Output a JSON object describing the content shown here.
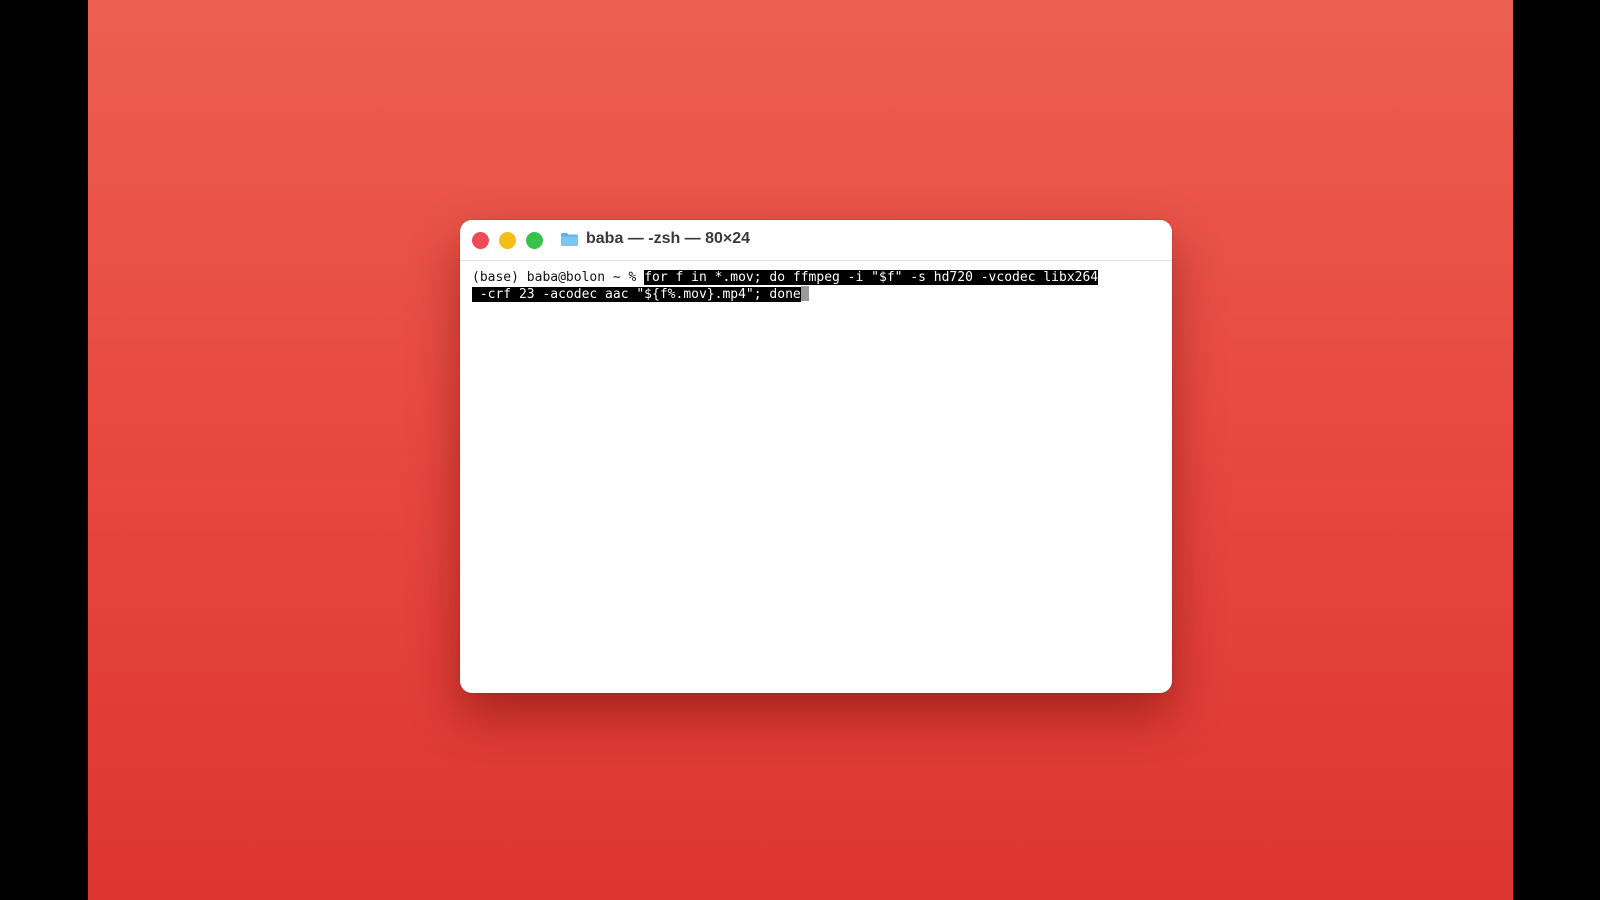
{
  "window": {
    "title": "baba — -zsh — 80×24"
  },
  "terminal": {
    "prompt": "(base) baba@bolon ~ % ",
    "command_line_1": "for f in *.mov; do ffmpeg -i \"$f\" -s hd720 -vcodec libx264",
    "command_line_2": " -crf 23 -acodec aac \"${f%.mov}.mp4\"; done"
  },
  "icons": {
    "close": "close-button",
    "minimize": "minimize-button",
    "zoom": "zoom-button",
    "folder": "folder-icon"
  },
  "colors": {
    "desktop_top": "#ec5f50",
    "desktop_bottom": "#dd3530",
    "close": "#ee4b57",
    "minimize": "#f3be1a",
    "zoom": "#37c24b",
    "selection_bg": "#000000",
    "selection_fg": "#ffffff"
  }
}
